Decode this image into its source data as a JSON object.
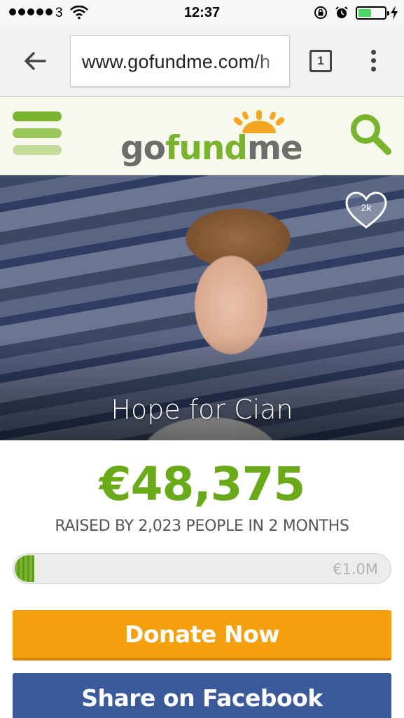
{
  "status_bar": {
    "carrier": "3",
    "time": "12:37",
    "battery_level": 0.5,
    "battery_color": "#4cd964"
  },
  "browser": {
    "url": "www.gofundme.com/h",
    "tab_count": "1",
    "icons": [
      "back-arrow-icon",
      "tabs-icon",
      "overflow-menu-icon"
    ]
  },
  "site": {
    "logo": {
      "part1": "go",
      "part2": "fund",
      "part3": "me"
    },
    "colors": {
      "brand_green": "#7ab32e",
      "header_bg": "#f6f9ec"
    },
    "icons": [
      "hamburger-menu-icon",
      "search-icon"
    ]
  },
  "campaign": {
    "title": "Hope for Cian",
    "likes": "2k",
    "amount_raised": "€48,375",
    "raised_caption": "RAISED BY 2,023 PEOPLE IN 2 MONTHS",
    "goal_label": "€1.0M",
    "progress_fraction": 0.048
  },
  "actions": {
    "donate_label": "Donate Now",
    "share_label": "Share on Facebook",
    "donate_color": "#f4a00f",
    "share_color": "#3b5a9c"
  }
}
